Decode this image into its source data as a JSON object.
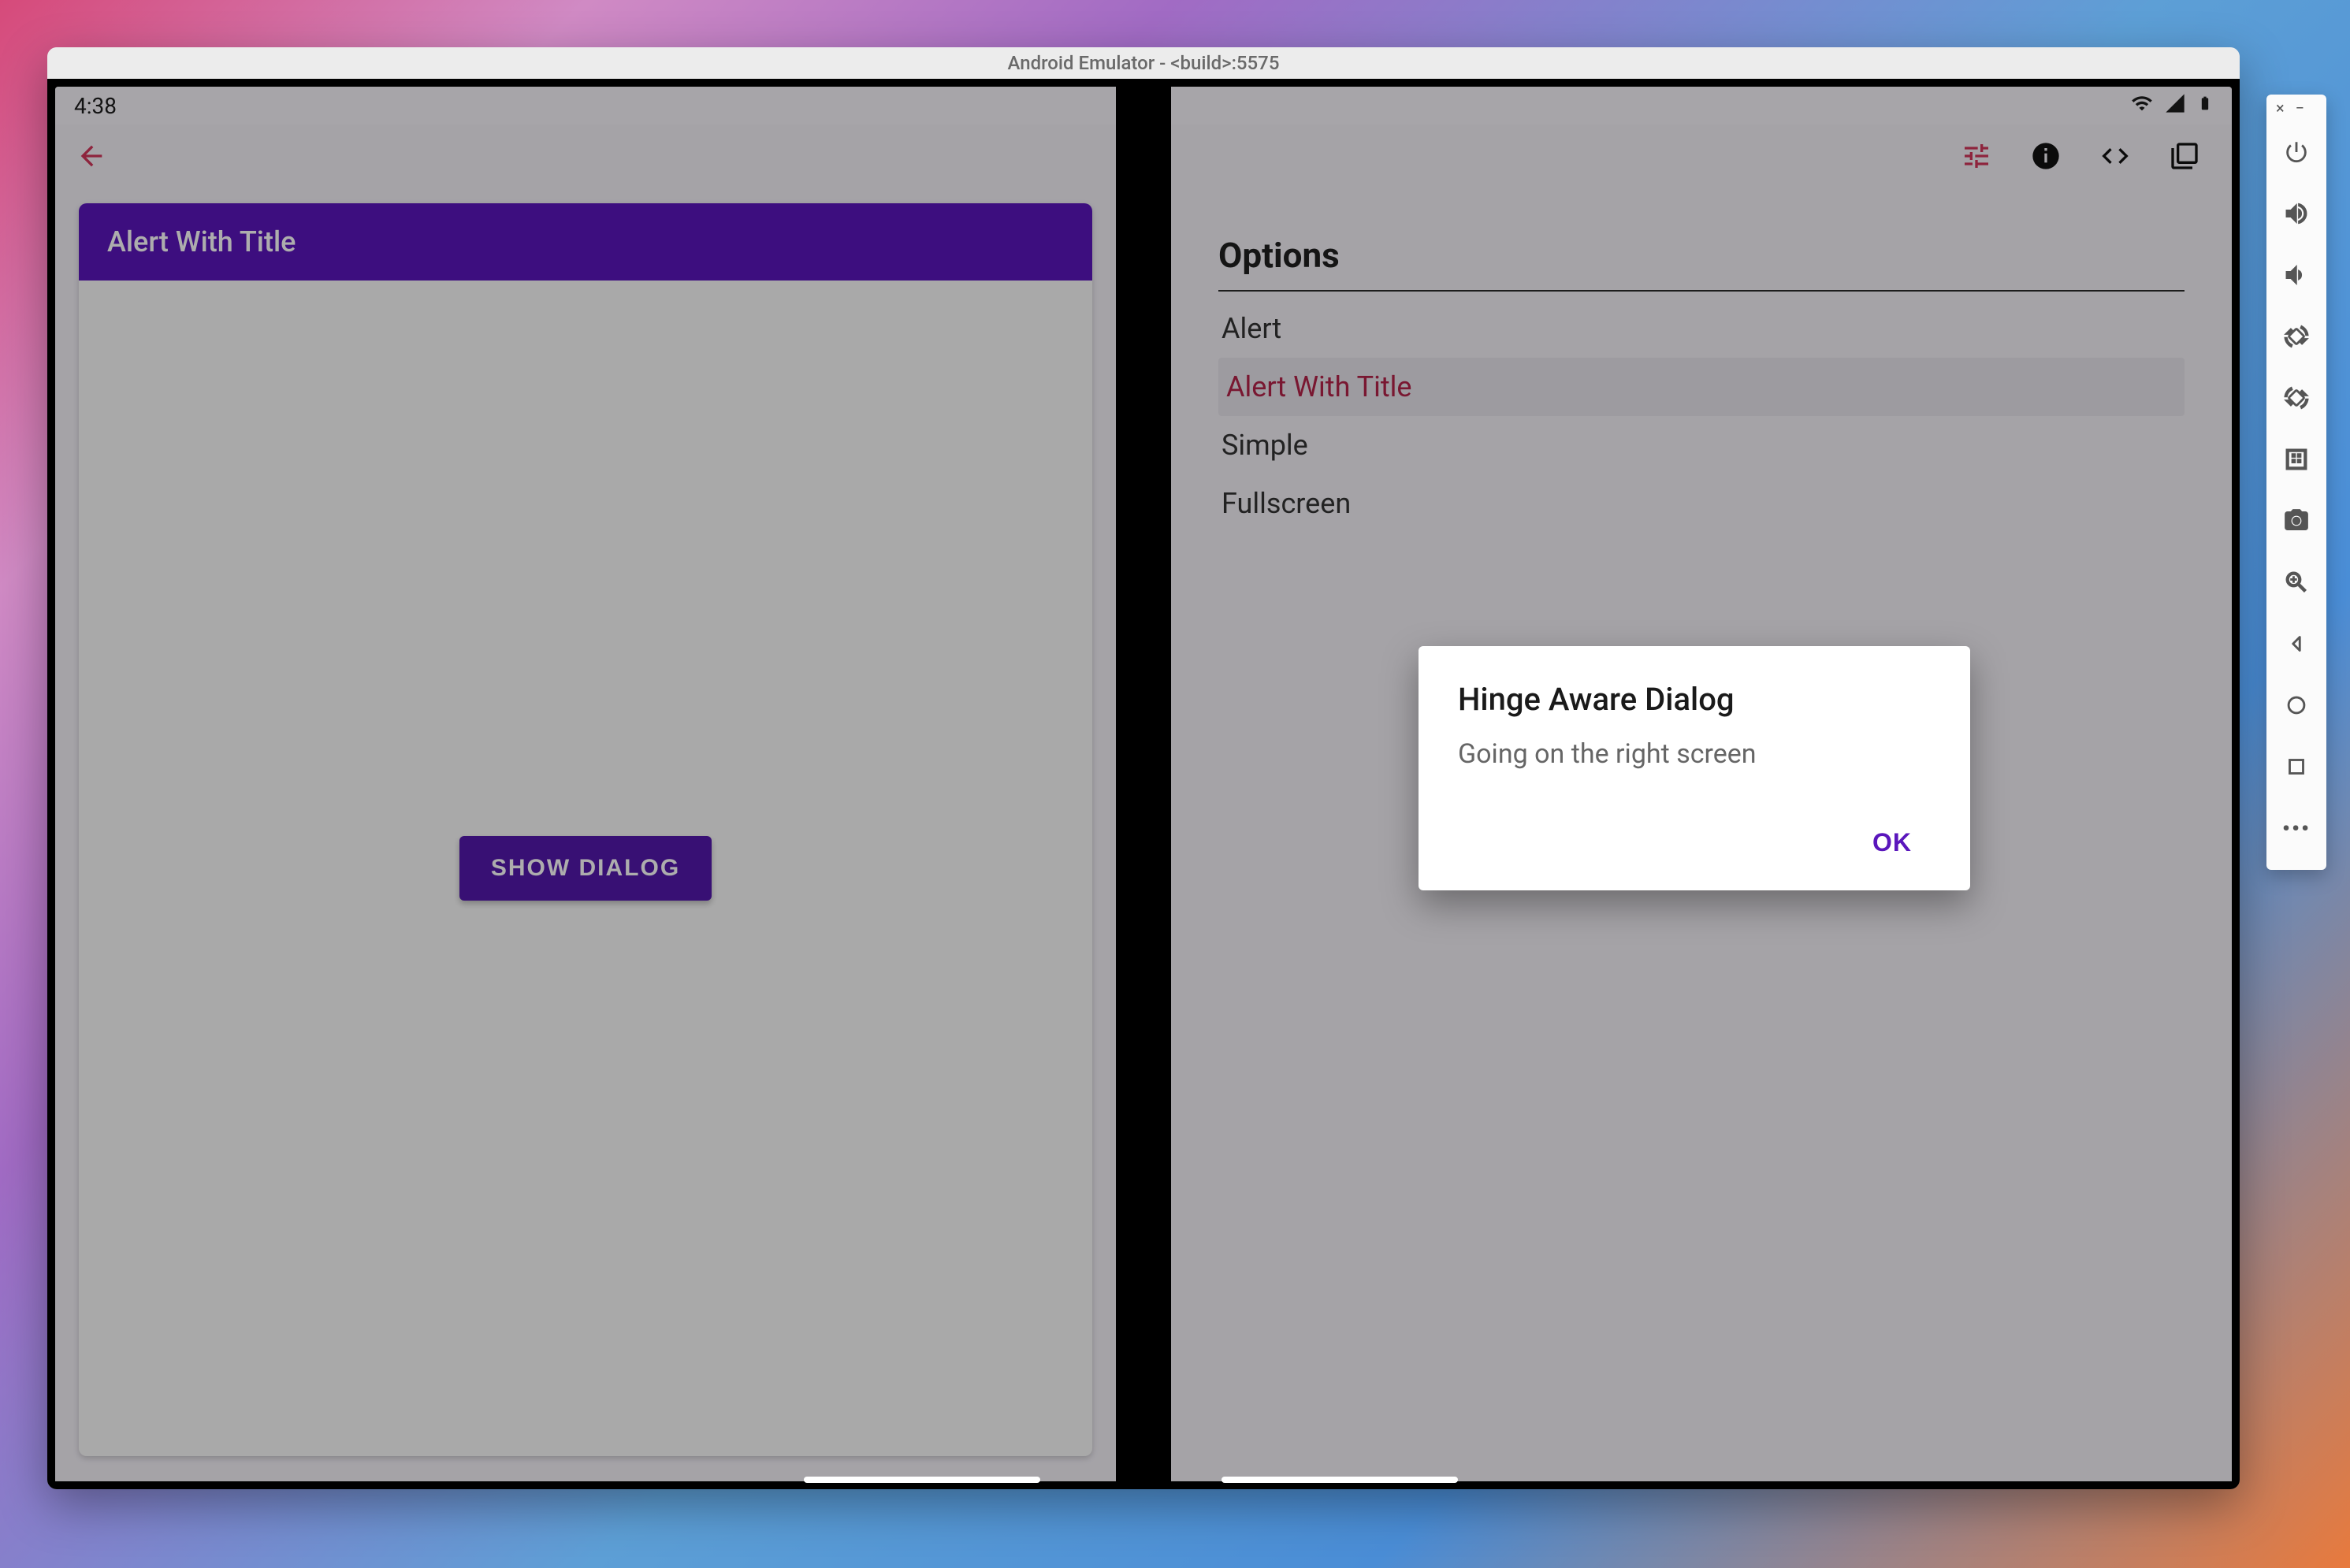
{
  "emulator": {
    "window_title": "Android Emulator - <build>:5575"
  },
  "statusbar": {
    "time": "4:38"
  },
  "left_screen": {
    "app_title": "Alert With Title",
    "show_button": "SHOW DIALOG"
  },
  "right_screen": {
    "options_heading": "Options",
    "options": [
      {
        "label": "Alert",
        "selected": false
      },
      {
        "label": "Alert With Title",
        "selected": true
      },
      {
        "label": "Simple",
        "selected": false
      },
      {
        "label": "Fullscreen",
        "selected": false
      }
    ]
  },
  "dialog": {
    "title": "Hinge Aware Dialog",
    "body": "Going on the right screen",
    "ok_label": "OK"
  },
  "toolbar_icons": {
    "tune": "tune-icon",
    "info": "info-icon",
    "code": "code-icon",
    "book": "book-icon"
  },
  "emu_tools": {
    "close": "×",
    "minimize": "−"
  }
}
